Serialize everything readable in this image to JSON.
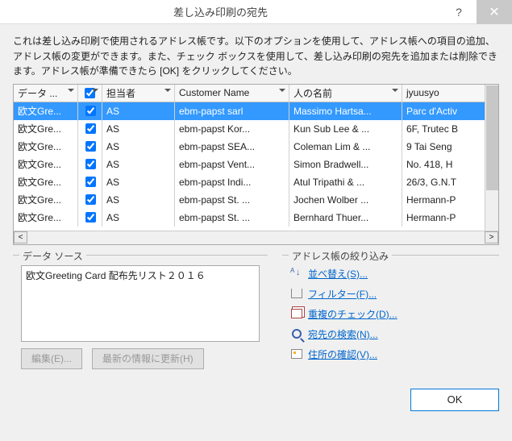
{
  "titlebar": {
    "title": "差し込み印刷の宛先"
  },
  "description": "これは差し込み印刷で使用されるアドレス帳です。以下のオプションを使用して、アドレス帳への項目の追加、アドレス帳の変更ができます。また、チェック ボックスを使用して、差し込み印刷の宛先を追加または削除できます。アドレス帳が準備できたら [OK] をクリックしてください。",
  "columns": {
    "c0": "データ ...",
    "c1": "",
    "c2": "担当者",
    "c3": "Customer Name",
    "c4": "人の名前",
    "c5": "jyuusyo"
  },
  "rows": [
    {
      "sel": true,
      "data": "欧文Gre...",
      "tantou": "AS",
      "cust": "ebm-papst sarl",
      "person": "Massimo Hartsa...",
      "addr": "Parc d'Activ"
    },
    {
      "sel": false,
      "data": "欧文Gre...",
      "tantou": "AS",
      "cust": "ebm-papst Kor...",
      "person": "Kun Sub Lee & ...",
      "addr": "6F, Trutec B"
    },
    {
      "sel": false,
      "data": "欧文Gre...",
      "tantou": "AS",
      "cust": "ebm-papst SEA...",
      "person": "Coleman Lim & ...",
      "addr": "9 Tai Seng "
    },
    {
      "sel": false,
      "data": "欧文Gre...",
      "tantou": "AS",
      "cust": "ebm-papst Vent...",
      "person": "Simon Bradwell...",
      "addr": " No. 418, H"
    },
    {
      "sel": false,
      "data": "欧文Gre...",
      "tantou": "AS",
      "cust": "ebm-papst Indi...",
      "person": "Atul Tripathi & ...",
      "addr": "26/3, G.N.T"
    },
    {
      "sel": false,
      "data": "欧文Gre...",
      "tantou": "AS",
      "cust": "ebm-papst St. ...",
      "person": "Jochen Wolber ...",
      "addr": "Hermann-P"
    },
    {
      "sel": false,
      "data": "欧文Gre...",
      "tantou": "AS",
      "cust": "ebm-papst St. ...",
      "person": "Bernhard Thuer...",
      "addr": "Hermann-P",
      "partial": true
    }
  ],
  "datasource": {
    "legend": "データ ソース",
    "item": "欧文Greeting Card 配布先リスト２０１６",
    "edit_btn": "編集(E)...",
    "refresh_btn": "最新の情報に更新(H)"
  },
  "refine": {
    "legend": "アドレス帳の絞り込み",
    "sort": "並べ替え(S)...",
    "filter": "フィルター(F)...",
    "dup": "重複のチェック(D)...",
    "find": "宛先の検索(N)...",
    "validate": "住所の確認(V)..."
  },
  "footer": {
    "ok": "OK"
  }
}
